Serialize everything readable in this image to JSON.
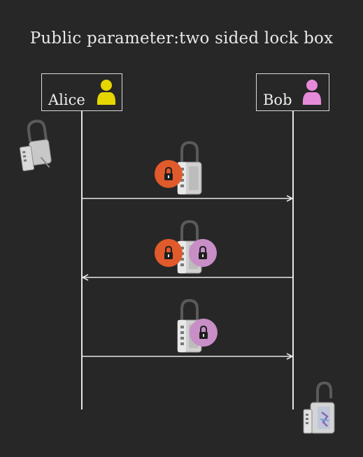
{
  "title": "Public parameter:two sided lock box",
  "actors": [
    {
      "name": "Alice",
      "icon": "person-icon",
      "color": "#e6d600"
    },
    {
      "name": "Bob",
      "icon": "person-icon",
      "color": "#e58ad9"
    }
  ],
  "messages": [
    {
      "from": "Alice",
      "to": "Bob",
      "locks": [
        "alice-lock"
      ]
    },
    {
      "from": "Bob",
      "to": "Alice",
      "locks": [
        "alice-lock",
        "bob-lock"
      ]
    },
    {
      "from": "Alice",
      "to": "Bob",
      "locks": [
        "bob-lock"
      ]
    }
  ],
  "colors": {
    "background": "#272727",
    "line": "#e6e6e6",
    "alice_lock": "#e15a2b",
    "bob_lock": "#c88ec6",
    "lockbox_body": "#cfcfcf",
    "shackle": "#5a5a5a"
  }
}
